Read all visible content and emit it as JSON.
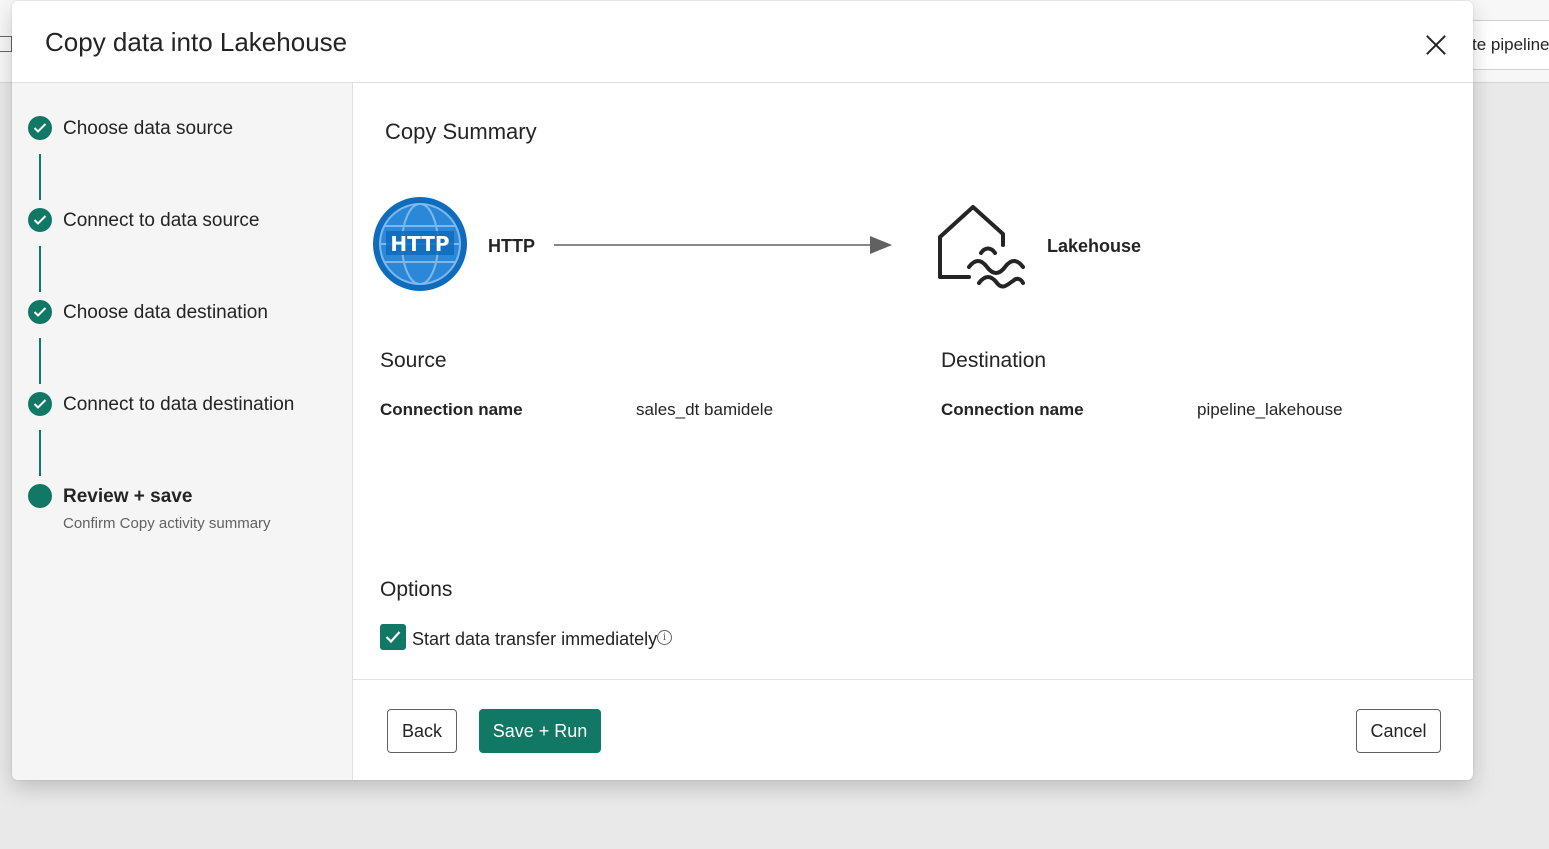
{
  "background": {
    "tab_text": "te pipeline"
  },
  "dialog": {
    "title": "Copy data into Lakehouse"
  },
  "steps": [
    {
      "label": "Choose data source",
      "status": "completed"
    },
    {
      "label": "Connect to data source",
      "status": "completed"
    },
    {
      "label": "Choose data destination",
      "status": "completed"
    },
    {
      "label": "Connect to data destination",
      "status": "completed"
    },
    {
      "label": "Review + save",
      "sub": "Confirm Copy activity summary",
      "status": "current"
    }
  ],
  "summary": {
    "heading": "Copy Summary",
    "source_icon_text": "HTTP",
    "source_label": "HTTP",
    "destination_label": "Lakehouse"
  },
  "source": {
    "heading": "Source",
    "connection_key": "Connection name",
    "connection_value": "sales_dt bamidele"
  },
  "destination": {
    "heading": "Destination",
    "connection_key": "Connection name",
    "connection_value": "pipeline_lakehouse"
  },
  "options": {
    "heading": "Options",
    "start_transfer_label": "Start data transfer immediately",
    "start_transfer_checked": true,
    "info_icon": "info-icon"
  },
  "buttons": {
    "back": "Back",
    "save_run": "Save + Run",
    "cancel": "Cancel"
  },
  "colors": {
    "accent": "#117865",
    "http_blue": "#0f6cbd"
  }
}
